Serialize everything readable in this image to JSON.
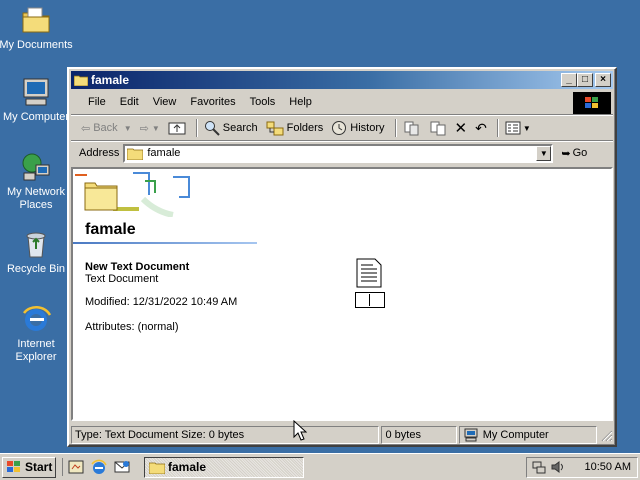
{
  "desktop": {
    "icons": [
      {
        "label": "My Documents",
        "icon": "my-documents-icon"
      },
      {
        "label": "My Computer",
        "icon": "my-computer-icon"
      },
      {
        "label": "My Network Places",
        "icon": "network-places-icon"
      },
      {
        "label": "Recycle Bin",
        "icon": "recycle-bin-icon"
      },
      {
        "label": "Internet Explorer",
        "icon": "internet-explorer-icon"
      }
    ]
  },
  "window": {
    "title": "famale",
    "controls": {
      "minimize": "_",
      "maximize": "□",
      "close": "×"
    },
    "menu": [
      "File",
      "Edit",
      "View",
      "Favorites",
      "Tools",
      "Help"
    ],
    "toolbar": {
      "back": "Back",
      "search": "Search",
      "folders": "Folders",
      "history": "History"
    },
    "address": {
      "label": "Address",
      "value": "famale",
      "go": "Go"
    },
    "content": {
      "folder_title": "famale",
      "item_name": "New Text Document",
      "item_type": "Text Document",
      "modified": "Modified: 12/31/2022 10:49 AM",
      "attributes": "Attributes: (normal)"
    },
    "status": {
      "left": "Type: Text Document Size: 0 bytes",
      "size": "0 bytes",
      "zone": "My Computer"
    }
  },
  "taskbar": {
    "start": "Start",
    "task": "famale",
    "clock": "10:50 AM"
  },
  "colors": {
    "desktop": "#3a6ea5",
    "title_active": "#0a246a",
    "face": "#d4d0c8"
  }
}
